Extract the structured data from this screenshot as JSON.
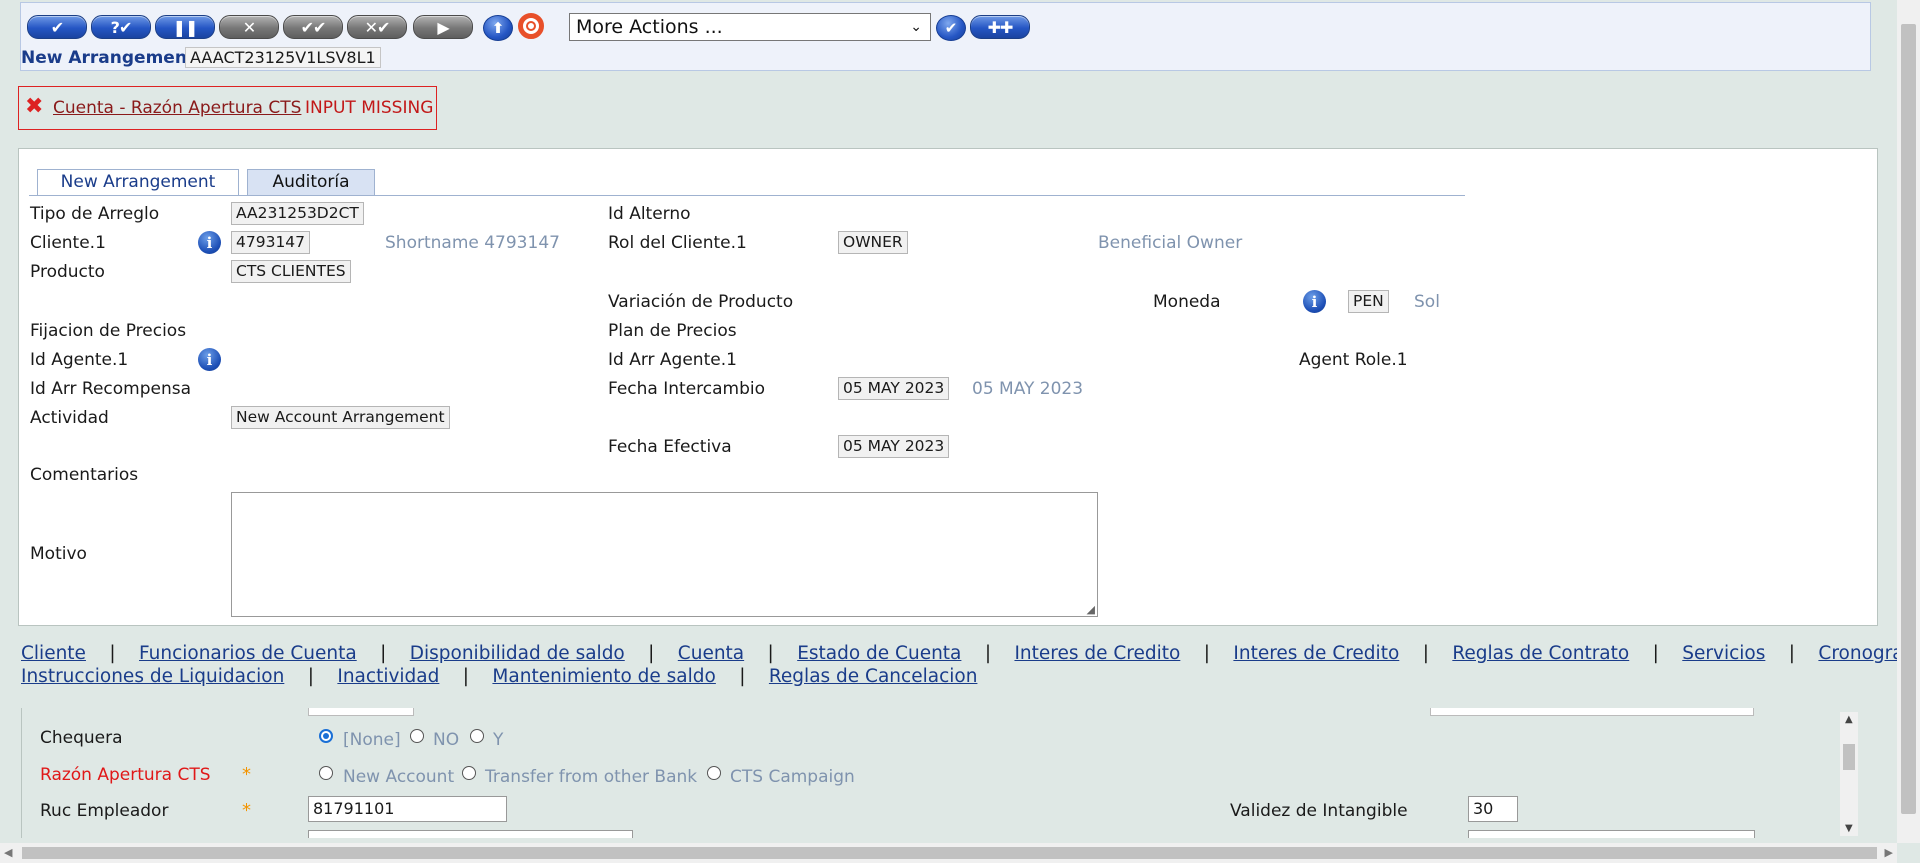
{
  "toolbar": {
    "buttons": [
      {
        "icon": "check-icon",
        "glyph": "✔"
      },
      {
        "icon": "question-check-icon",
        "glyph": "?✔"
      },
      {
        "icon": "pause-icon",
        "glyph": "❚❚"
      },
      {
        "icon": "close-icon",
        "glyph": "✕"
      },
      {
        "icon": "double-check-icon",
        "glyph": "✔✔"
      },
      {
        "icon": "cross-check-icon",
        "glyph": "✕✔"
      },
      {
        "icon": "play-icon",
        "glyph": "▶"
      }
    ],
    "more_actions_value": "More Actions ...",
    "arrangement_label": "New Arrangement",
    "arrangement_id": "AAACT23125V1LSV8L1"
  },
  "error": {
    "link_text": "Cuenta - Razón Apertura CTS",
    "message": "INPUT MISSING"
  },
  "tabs": {
    "active": "New Arrangement",
    "other": "Auditoría"
  },
  "form": {
    "tipo_arreglo_label": "Tipo de Arreglo",
    "tipo_arreglo_value": "AA231253D2CT",
    "id_alterno_label": "Id Alterno",
    "cliente_label": "Cliente.1",
    "cliente_value": "4793147",
    "shortname": "Shortname 4793147",
    "rol_label": "Rol del Cliente.1",
    "rol_value": "OWNER",
    "rol_desc": "Beneficial Owner",
    "producto_label": "Producto",
    "producto_value": "CTS CLIENTES",
    "variacion_label": "Variación de Producto",
    "moneda_label": "Moneda",
    "moneda_value": "PEN",
    "moneda_desc": "Sol",
    "fijacion_label": "Fijacion de Precios",
    "plan_label": "Plan de Precios",
    "id_agente_label": "Id Agente.1",
    "id_arr_agente_label": "Id Arr Agente.1",
    "agent_role_label": "Agent Role.1",
    "id_arr_recompensa_label": "Id Arr Recompensa",
    "fecha_intercambio_label": "Fecha Intercambio",
    "fecha_intercambio_value": "05 MAY 2023",
    "fecha_intercambio_desc": "05 MAY 2023",
    "actividad_label": "Actividad",
    "actividad_value": "New Account Arrangement",
    "fecha_efectiva_label": "Fecha Efectiva",
    "fecha_efectiva_value": "05 MAY 2023",
    "comentarios_label": "Comentarios",
    "motivo_label": "Motivo"
  },
  "links": {
    "row1": [
      "Cliente",
      "Funcionarios de Cuenta",
      "Disponibilidad de saldo",
      "Cuenta",
      "Estado de Cuenta",
      "Interes de Credito",
      "Interes de Credito",
      "Reglas de Contrato",
      "Servicios",
      "Cronograma"
    ],
    "row2": [
      "Instrucciones de Liquidacion",
      "Inactividad",
      "Mantenimiento de saldo",
      "Reglas de Cancelacion"
    ],
    "separator": "|"
  },
  "bottom": {
    "chequera_label": "Chequera",
    "chequera_options": [
      "[None]",
      "NO",
      "Y"
    ],
    "chequera_selected": "[None]",
    "razon_label": "Razón Apertura CTS",
    "razon_options": [
      "New Account",
      "Transfer from other Bank",
      "CTS Campaign"
    ],
    "required_mark": "*",
    "ruc_label": "Ruc Empleador",
    "ruc_value": "81791101",
    "validez_label": "Validez de Intangible",
    "validez_value": "30"
  },
  "colors": {
    "error": "#d22222",
    "link": "#1a3c8a",
    "required": "#f39400",
    "background": "#dfe8e5"
  }
}
